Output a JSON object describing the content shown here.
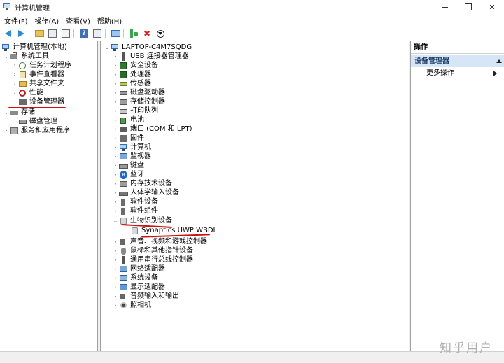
{
  "window": {
    "title": "计算机管理"
  },
  "menu": [
    "文件(F)",
    "操作(A)",
    "查看(V)",
    "帮助(H)"
  ],
  "left_tree": {
    "root": "计算机管理(本地)",
    "system_tools": "系统工具",
    "task_scheduler": "任务计划程序",
    "event_viewer": "事件查看器",
    "shared_folders": "共享文件夹",
    "performance": "性能",
    "device_manager": "设备管理器",
    "storage": "存储",
    "disk_management": "磁盘管理",
    "services_apps": "服务和应用程序"
  },
  "device_tree": {
    "computer_name": "LAPTOP-C4M7SQDG",
    "categories": [
      "USB 连接器管理器",
      "安全设备",
      "处理器",
      "传感器",
      "磁盘驱动器",
      "存储控制器",
      "打印队列",
      "电池",
      "端口 (COM 和 LPT)",
      "固件",
      "计算机",
      "监视器",
      "键盘",
      "蓝牙",
      "内存技术设备",
      "人体学输入设备",
      "软件设备",
      "软件组件",
      "生物识别设备",
      "声音、视频和游戏控制器",
      "鼠标和其他指针设备",
      "通用串行总线控制器",
      "网络适配器",
      "系统设备",
      "显示适配器",
      "音频输入和输出",
      "照相机"
    ],
    "biometric_child": "Synaptics UWP WBDI"
  },
  "actions": {
    "header": "操作",
    "section": "设备管理器",
    "more": "更多操作"
  },
  "watermark": "知乎用户"
}
